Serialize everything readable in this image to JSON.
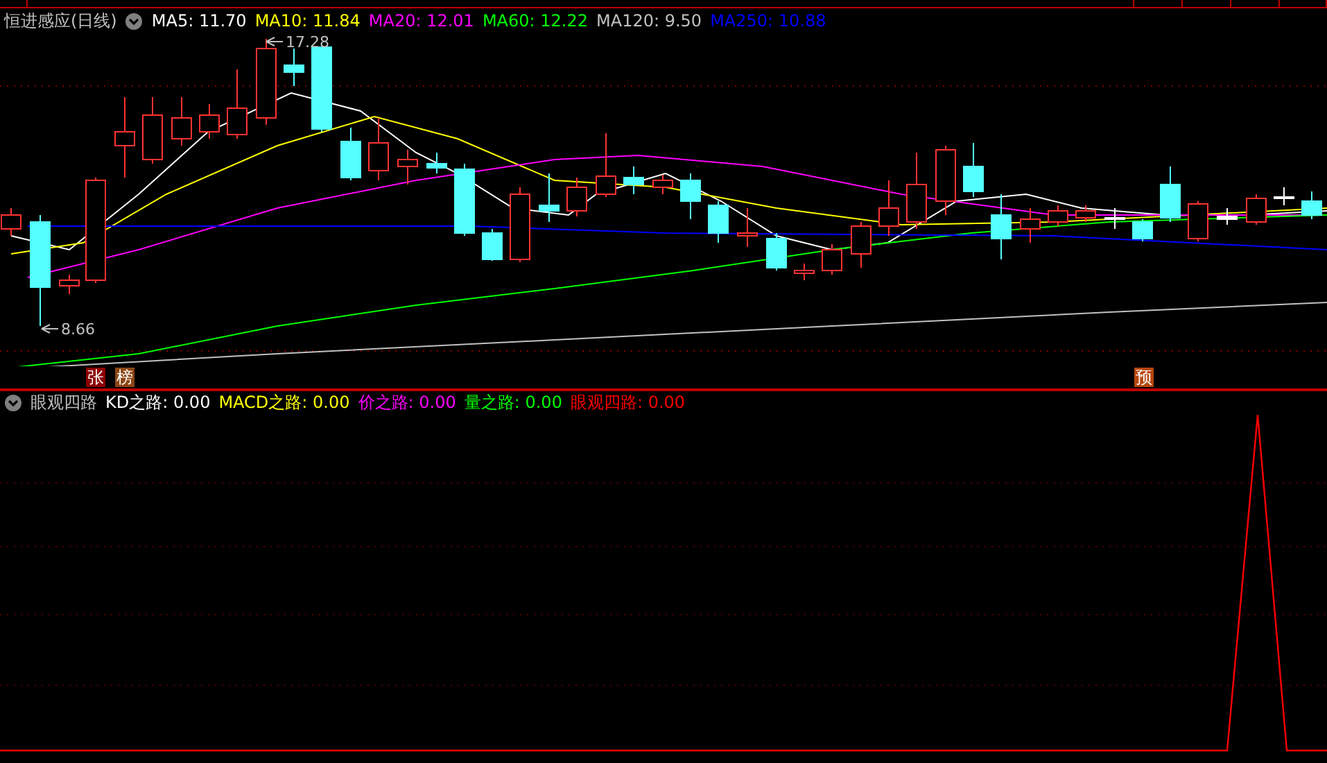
{
  "chart_title": "恒进感应(日线)",
  "moving_averages": [
    {
      "label": "MA5:",
      "value": "11.70",
      "color": "#ffffff"
    },
    {
      "label": "MA10:",
      "value": "11.84",
      "color": "#ffff00"
    },
    {
      "label": "MA20:",
      "value": "12.01",
      "color": "#ff00ff"
    },
    {
      "label": "MA60:",
      "value": "12.22",
      "color": "#00ff00"
    },
    {
      "label": "MA120:",
      "value": "9.50",
      "color": "#c0c0c0"
    },
    {
      "label": "MA250:",
      "value": "10.88",
      "color": "#0000ff"
    }
  ],
  "price_labels": [
    {
      "kind": "high",
      "text": "17.28"
    },
    {
      "kind": "low",
      "text": "8.66"
    }
  ],
  "markers": [
    {
      "text": "张",
      "color": "#8b0000"
    },
    {
      "text": "榜",
      "color": "#8b4513"
    },
    {
      "text": "预",
      "color": "#b8450c"
    }
  ],
  "indicator": {
    "title": "眼观四路",
    "items": [
      {
        "label": "KD之路:",
        "value": "0.00",
        "color": "#ffffff"
      },
      {
        "label": "MACD之路:",
        "value": "0.00",
        "color": "#ffff00"
      },
      {
        "label": "价之路:",
        "value": "0.00",
        "color": "#ff00ff"
      },
      {
        "label": "量之路:",
        "value": "0.00",
        "color": "#00ff00"
      },
      {
        "label": "眼观四路:",
        "value": "0.00",
        "color": "#ff0000"
      }
    ]
  }
}
